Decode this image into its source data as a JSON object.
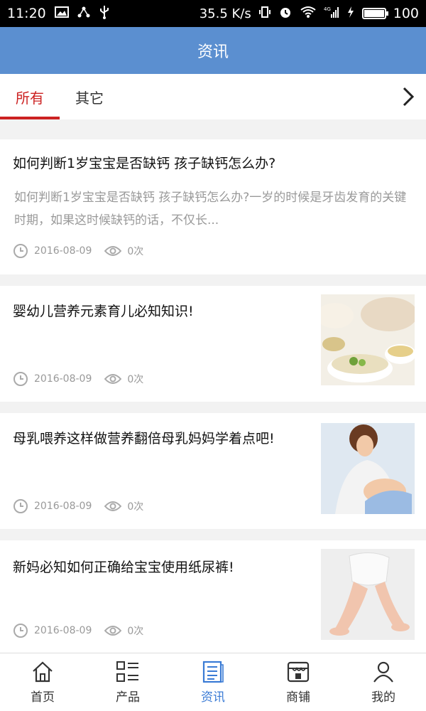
{
  "status_bar": {
    "time": "11:20",
    "speed": "35.5 K/s",
    "battery": "100",
    "battery_level": 1.0,
    "network": "4G"
  },
  "header": {
    "title": "资讯"
  },
  "tabs": [
    {
      "label": "所有",
      "active": true
    },
    {
      "label": "其它",
      "active": false
    }
  ],
  "articles": [
    {
      "title": "如何判断1岁宝宝是否缺钙 孩子缺钙怎么办?",
      "desc": "如何判断1岁宝宝是否缺钙 孩子缺钙怎么办?一岁的时候是牙齿发育的关键时期，如果这时候缺钙的话，不仅长...",
      "date": "2016-08-09",
      "views": "0次"
    },
    {
      "title": "婴幼儿营养元素育儿必知知识!",
      "date": "2016-08-09",
      "views": "0次"
    },
    {
      "title": "母乳喂养这样做营养翻倍母乳妈妈学着点吧!",
      "date": "2016-08-09",
      "views": "0次"
    },
    {
      "title": "新妈必知如何正确给宝宝使用纸尿裤!",
      "date": "2016-08-09",
      "views": "0次"
    }
  ],
  "bottom_nav": [
    {
      "label": "首页",
      "icon": "home-icon"
    },
    {
      "label": "产品",
      "icon": "grid-list-icon"
    },
    {
      "label": "资讯",
      "icon": "news-icon",
      "active": true
    },
    {
      "label": "商铺",
      "icon": "shop-icon"
    },
    {
      "label": "我的",
      "icon": "user-icon"
    }
  ],
  "colors": {
    "header_bg": "#5b8fd0",
    "tab_active": "#cc2222",
    "nav_active": "#3a7bd5"
  }
}
